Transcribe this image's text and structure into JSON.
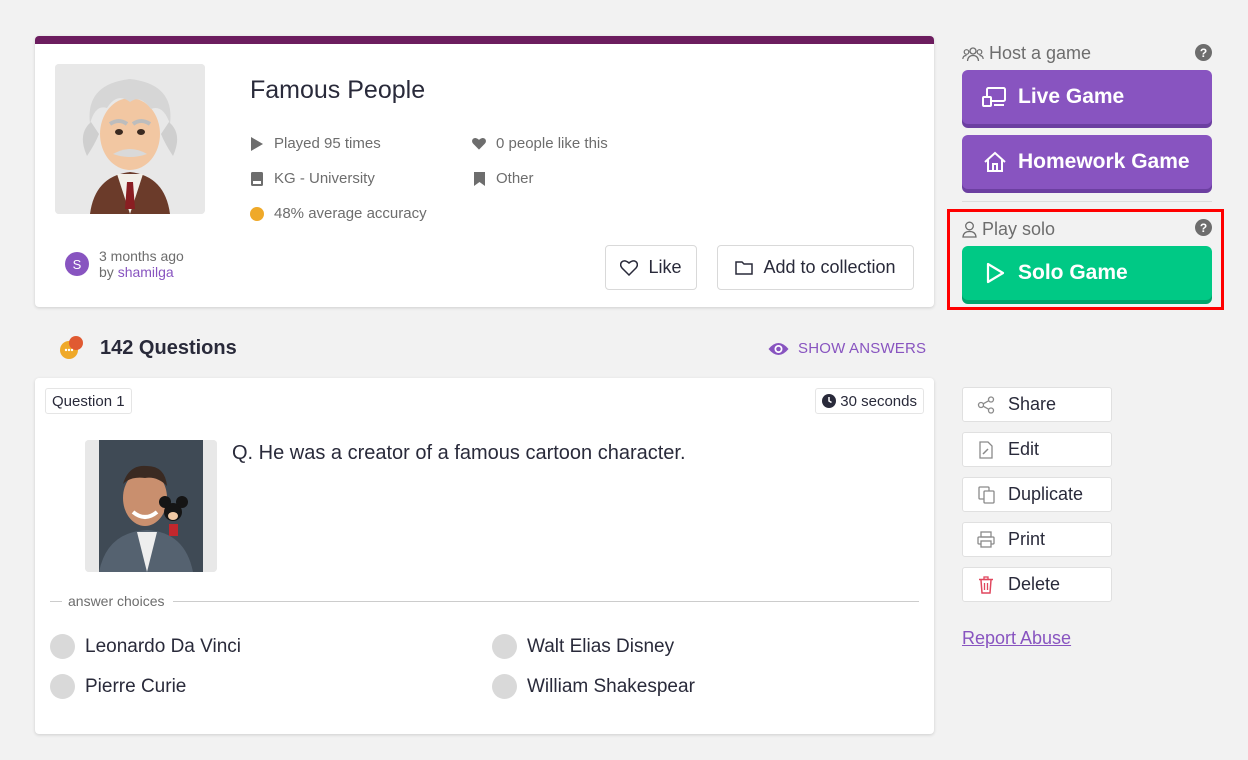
{
  "quiz": {
    "title": "Famous People",
    "played": "Played 95 times",
    "likes": "0 people like this",
    "grade": "KG - University",
    "subject": "Other",
    "accuracy": "48% average accuracy",
    "time_ago": "3 months ago",
    "by_prefix": "by ",
    "author": "shamilga",
    "avatar_initial": "S",
    "like_label": "Like",
    "collection_label": "Add to collection"
  },
  "questions": {
    "count_label": "142 Questions",
    "show_answers": "SHOW ANSWERS"
  },
  "question": {
    "number": "Question 1",
    "time": "30 seconds",
    "text": "Q. He was a creator of a famous cartoon character.",
    "answer_choices_label": "answer choices",
    "answers": [
      "Leonardo Da Vinci",
      "Walt Elias Disney",
      "Pierre Curie",
      "William Shakespear"
    ]
  },
  "sidebar": {
    "host_label": "Host a game",
    "live_game": "Live Game",
    "homework_game": "Homework Game",
    "solo_label": "Play solo",
    "solo_game": "Solo Game",
    "help_glyph": "?",
    "actions": [
      "Share",
      "Edit",
      "Duplicate",
      "Print",
      "Delete"
    ],
    "report": "Report Abuse"
  },
  "colors": {
    "brand_purple": "#8854c0",
    "solo_green": "#00c985",
    "topbar": "#6c1d5f",
    "highlight_red": "#ff0000"
  },
  "icons": [
    "play-icon",
    "heart-icon",
    "book-icon",
    "bookmark-icon",
    "accuracy-dot-icon",
    "eye-icon",
    "clock-icon",
    "users-icon",
    "monitor-icon",
    "home-icon",
    "user-icon",
    "share-icon",
    "edit-icon",
    "duplicate-icon",
    "print-icon",
    "trash-icon",
    "folder-icon"
  ]
}
